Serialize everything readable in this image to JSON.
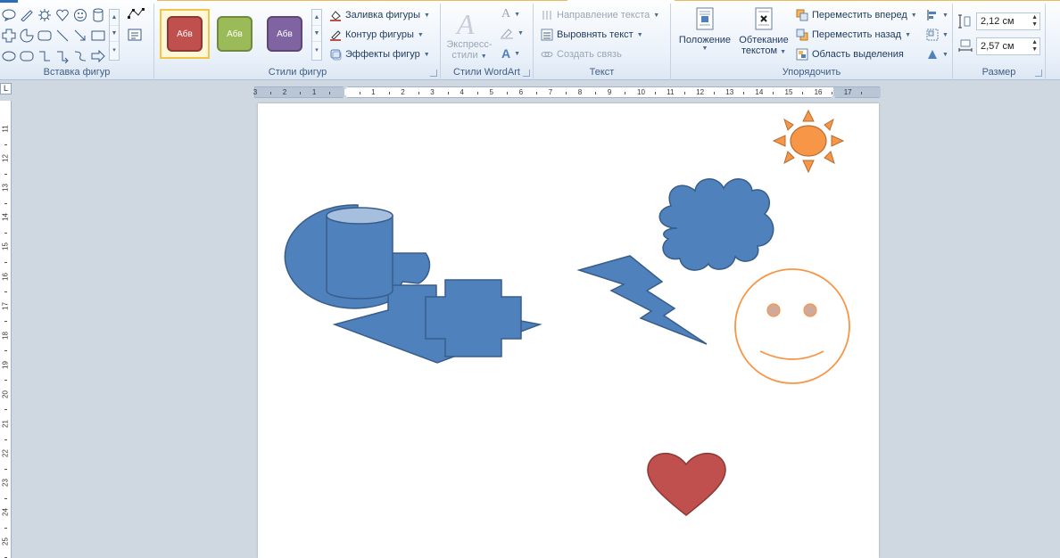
{
  "ribbon": {
    "groups": {
      "insert_shapes": "Вставка фигур",
      "shape_styles": "Стили фигур",
      "wordart_styles": "Стили WordArt",
      "text": "Текст",
      "arrange": "Упорядочить",
      "size": "Размер"
    },
    "style_swatches": [
      {
        "label": "Абв",
        "color": "#c0504d"
      },
      {
        "label": "Абв",
        "color": "#9bbb59"
      },
      {
        "label": "Абв",
        "color": "#8064a2"
      }
    ],
    "shape_style_cmds": {
      "fill": "Заливка фигуры",
      "outline": "Контур фигуры",
      "effects": "Эффекты фигур"
    },
    "wordart": {
      "express_styles_line1": "Экспресс-",
      "express_styles_line2": "стили"
    },
    "text_cmds": {
      "direction": "Направление текста",
      "align": "Выровнять текст",
      "link": "Создать связь"
    },
    "arrange_cmds": {
      "position": "Положение",
      "wrap_line1": "Обтекание",
      "wrap_line2": "текстом",
      "bring_forward": "Переместить вперед",
      "send_backward": "Переместить назад",
      "selection_pane": "Область выделения"
    },
    "size": {
      "height": "2,12 см",
      "width": "2,57 см"
    }
  },
  "ruler": {
    "corner": "L",
    "h_labels": [
      "3",
      "2",
      "1",
      "1",
      "2",
      "3",
      "4",
      "5",
      "6",
      "7",
      "8",
      "9",
      "10",
      "11",
      "12",
      "13",
      "14",
      "15",
      "16",
      "17"
    ],
    "v_labels": [
      "11",
      "12",
      "13",
      "14",
      "15",
      "16",
      "17",
      "18",
      "19",
      "20",
      "21",
      "22",
      "23",
      "24",
      "25"
    ]
  },
  "colors": {
    "blue_shape": "#4f81bd",
    "blue_stroke": "#385d8a",
    "orange": "#f79646",
    "red": "#c0504d"
  }
}
